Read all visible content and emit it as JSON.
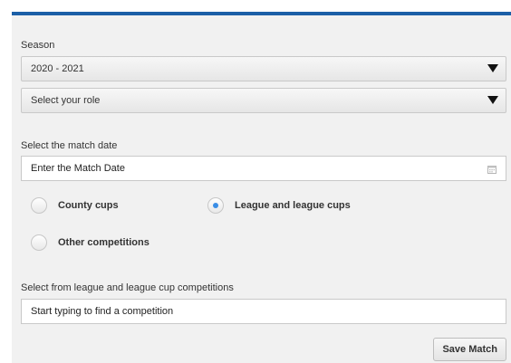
{
  "colors": {
    "accent_bar": "#1b5fa7",
    "radio_selected": "#3a8ee6"
  },
  "season": {
    "label": "Season",
    "selected": "2020 - 2021"
  },
  "role": {
    "selected": "Select your role"
  },
  "match_date": {
    "label": "Select the match date",
    "placeholder": "Enter the Match Date",
    "icon": "calendar-icon"
  },
  "competition_type": {
    "options": [
      {
        "label": "County cups",
        "selected": false
      },
      {
        "label": "League and league cups",
        "selected": true
      },
      {
        "label": "Other competitions",
        "selected": false
      }
    ]
  },
  "competition_search": {
    "label": "Select from league and league cup competitions",
    "placeholder": "Start typing to find a competition"
  },
  "save_button": {
    "label": "Save Match"
  }
}
